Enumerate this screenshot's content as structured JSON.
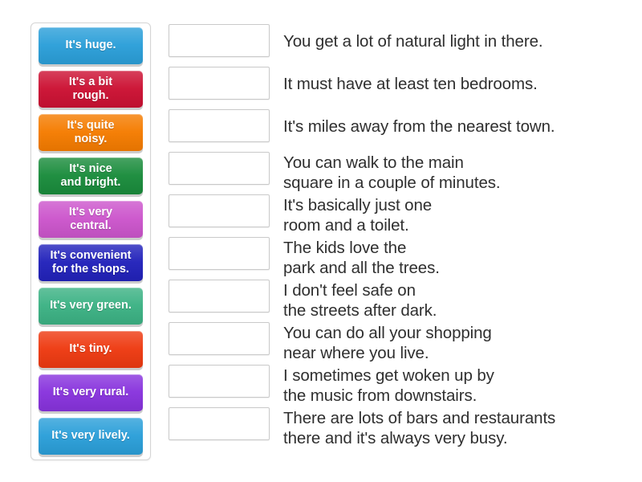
{
  "activity": {
    "type": "match-up",
    "background_color": "#ffffff",
    "text_color": "#2f2f2f",
    "dropzone_border_color": "#c9c9c9",
    "panel_border_color": "#d5d5d5"
  },
  "tiles": [
    {
      "label": "It's huge.",
      "color": "#2b9fd9",
      "lines": 1
    },
    {
      "label": "It's a bit\nrough.",
      "color": "#cc1133",
      "lines": 2
    },
    {
      "label": "It's quite\nnoisy.",
      "color": "#f57c00",
      "lines": 2
    },
    {
      "label": "It's nice\nand bright.",
      "color": "#1a8c3c",
      "lines": 2
    },
    {
      "label": "It's very\ncentral.",
      "color": "#cc55cc",
      "lines": 2
    },
    {
      "label": "It's convenient\nfor the shops.",
      "color": "#2222bb",
      "lines": 2
    },
    {
      "label": "It's very green.",
      "color": "#3cb284",
      "lines": 1
    },
    {
      "label": "It's tiny.",
      "color": "#ee3a11",
      "lines": 1
    },
    {
      "label": "It's very rural.",
      "color": "#8833dd",
      "lines": 1
    },
    {
      "label": "It's very lively.",
      "color": "#2b9fd9",
      "lines": 1
    }
  ],
  "rows": [
    {
      "dropzone_value": "",
      "prompt": "You get a lot of natural light in there.",
      "prompt_lines": 1
    },
    {
      "dropzone_value": "",
      "prompt": "It must have at least ten bedrooms.",
      "prompt_lines": 1
    },
    {
      "dropzone_value": "",
      "prompt": "It's miles away from the nearest town.",
      "prompt_lines": 1
    },
    {
      "dropzone_value": "",
      "prompt": "You can walk to the main\nsquare in a couple of minutes.",
      "prompt_lines": 2
    },
    {
      "dropzone_value": "",
      "prompt": "It's basically just one\nroom and a toilet.",
      "prompt_lines": 2
    },
    {
      "dropzone_value": "",
      "prompt": "The kids love the\npark and all the trees.",
      "prompt_lines": 2
    },
    {
      "dropzone_value": "",
      "prompt": "I don't feel safe on\nthe streets after dark.",
      "prompt_lines": 2
    },
    {
      "dropzone_value": "",
      "prompt": "You can do all your shopping\nnear where you live.",
      "prompt_lines": 2
    },
    {
      "dropzone_value": "",
      "prompt": "I sometimes get woken up by\nthe music from downstairs.",
      "prompt_lines": 2
    },
    {
      "dropzone_value": "",
      "prompt": "There are lots of bars and restaurants\nthere and it's always very busy.",
      "prompt_lines": 2
    }
  ]
}
